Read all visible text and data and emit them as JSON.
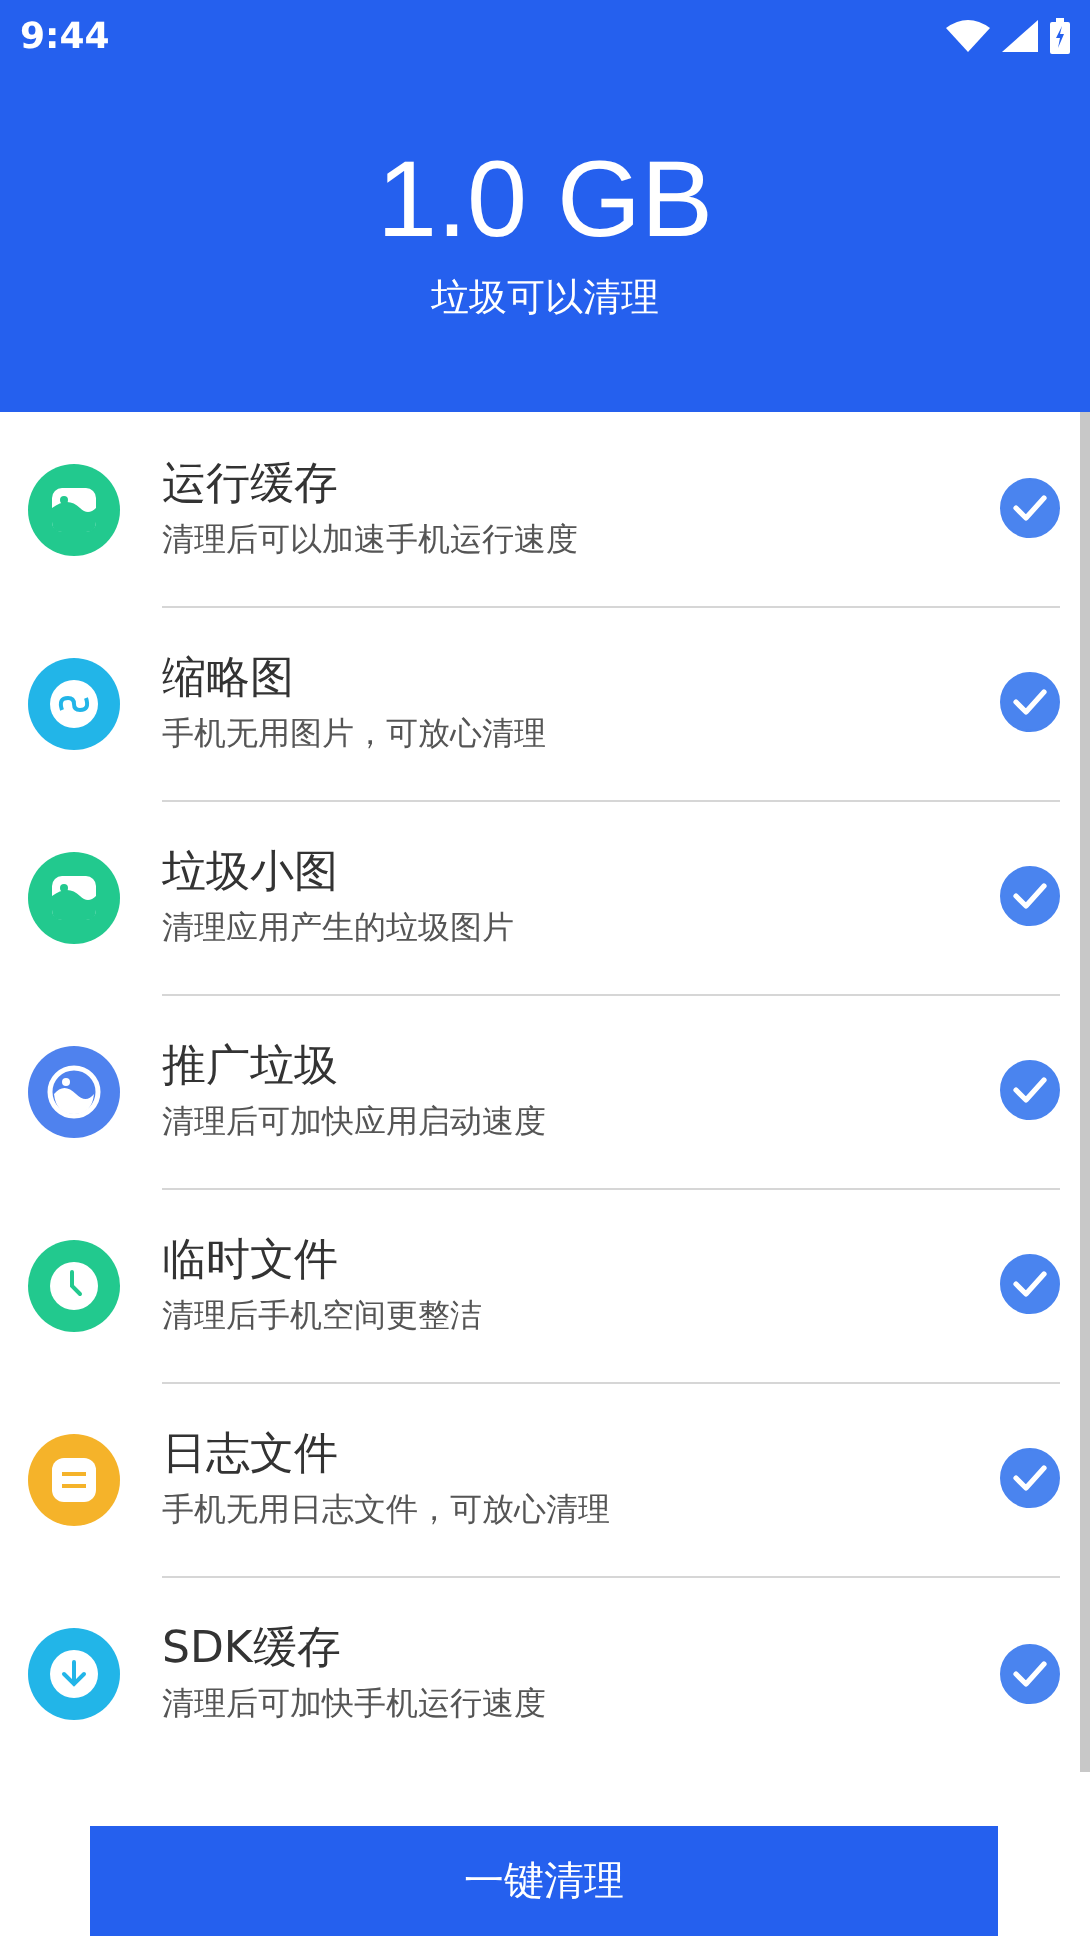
{
  "status_bar": {
    "time": "9:44"
  },
  "header": {
    "amount": "1.0 GB",
    "caption": "垃圾可以清理"
  },
  "items": [
    {
      "title": "运行缓存",
      "subtitle": "清理后可以加速手机运行速度",
      "kind": "picture",
      "color": "#22c98e",
      "checked": true
    },
    {
      "title": "缩略图",
      "subtitle": "手机无用图片，可放心清理",
      "kind": "link",
      "color": "#22b5e8",
      "checked": true
    },
    {
      "title": "垃圾小图",
      "subtitle": "清理应用产生的垃圾图片",
      "kind": "picture",
      "color": "#22c98e",
      "checked": true
    },
    {
      "title": "推广垃圾",
      "subtitle": "清理后可加快应用启动速度",
      "kind": "face",
      "color": "#4f82ee",
      "checked": true
    },
    {
      "title": "临时文件",
      "subtitle": "清理后手机空间更整洁",
      "kind": "clock",
      "color": "#22c98e",
      "checked": true
    },
    {
      "title": "日志文件",
      "subtitle": "手机无用日志文件，可放心清理",
      "kind": "notes",
      "color": "#f5b32a",
      "checked": true
    },
    {
      "title": "SDK缓存",
      "subtitle": "清理后可加快手机运行速度",
      "kind": "download",
      "color": "#22b5e8",
      "checked": true
    }
  ],
  "button": {
    "label": "一键清理"
  }
}
